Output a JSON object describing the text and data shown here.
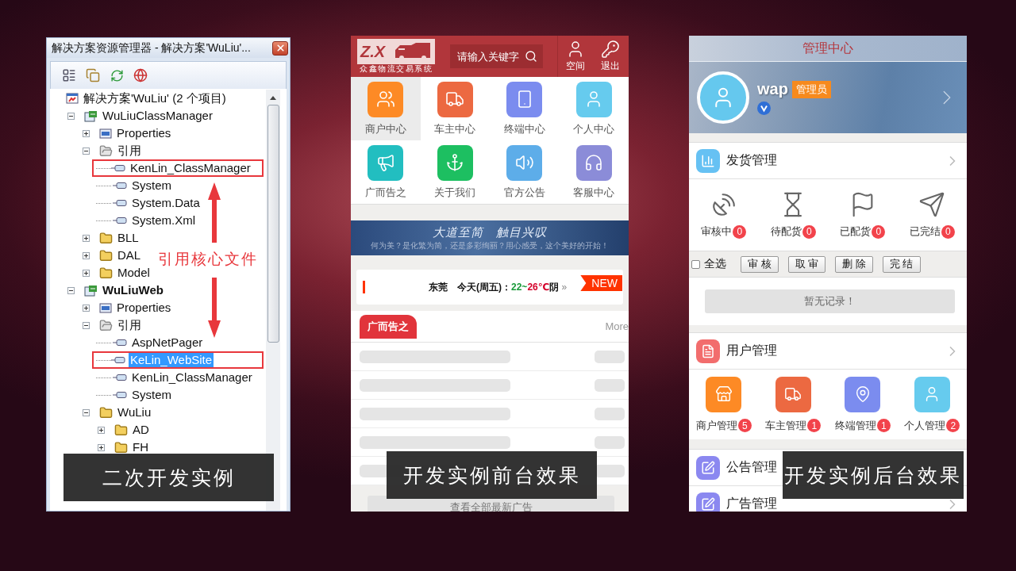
{
  "explorer": {
    "title": "解决方案资源管理器 - 解决方案'WuLiu'...",
    "tree": {
      "label": "解决方案'WuLiu' (2 个项目)",
      "kind": "solution",
      "selected": false,
      "children": [
        {
          "label": "WuLiuClassManager",
          "kind": "project",
          "selected": false,
          "bold": false,
          "expanded": true,
          "children": [
            {
              "label": "Properties",
              "kind": "properties",
              "selected": false,
              "expanded": false
            },
            {
              "label": "引用",
              "kind": "references",
              "selected": false,
              "expanded": true,
              "children": [
                {
                  "label": "KenLin_ClassManager",
                  "kind": "reference",
                  "selected": false,
                  "boxed": true
                },
                {
                  "label": "System",
                  "kind": "reference",
                  "selected": false,
                  "boxed": false
                },
                {
                  "label": "System.Data",
                  "kind": "reference",
                  "selected": false,
                  "boxed": false
                },
                {
                  "label": "System.Xml",
                  "kind": "reference",
                  "selected": false,
                  "boxed": false
                }
              ]
            },
            {
              "label": "BLL",
              "kind": "folder",
              "selected": false,
              "expanded": false
            },
            {
              "label": "DAL",
              "kind": "folder",
              "selected": false,
              "expanded": false
            },
            {
              "label": "Model",
              "kind": "folder",
              "selected": false,
              "expanded": false
            }
          ]
        },
        {
          "label": "WuLiuWeb",
          "kind": "project",
          "selected": false,
          "bold": true,
          "expanded": true,
          "children": [
            {
              "label": "Properties",
              "kind": "properties",
              "selected": false,
              "expanded": false
            },
            {
              "label": "引用",
              "kind": "references",
              "selected": false,
              "expanded": true,
              "children": [
                {
                  "label": "AspNetPager",
                  "kind": "reference",
                  "selected": false,
                  "boxed": false
                },
                {
                  "label": "KeLin_WebSite",
                  "kind": "reference",
                  "selected": true,
                  "boxed": true
                },
                {
                  "label": "KenLin_ClassManager",
                  "kind": "reference",
                  "selected": false,
                  "boxed": false
                },
                {
                  "label": "System",
                  "kind": "reference",
                  "selected": false,
                  "boxed": false
                }
              ]
            },
            {
              "label": "WuLiu",
              "kind": "folder",
              "selected": false,
              "expanded": true,
              "children": [
                {
                  "label": "AD",
                  "kind": "folder",
                  "selected": false,
                  "expanded": false
                },
                {
                  "label": "FH",
                  "kind": "folder",
                  "selected": false,
                  "expanded": false
                }
              ]
            }
          ]
        }
      ]
    },
    "annotation": "引用核心文件",
    "caption": "二次开发实例"
  },
  "front": {
    "logo": {
      "mark": "Z.X",
      "subtitle": "众鑫物流交易系统"
    },
    "search": {
      "placeholder": "请输入关键字"
    },
    "header_links": [
      {
        "label": "空间"
      },
      {
        "label": "退出"
      }
    ],
    "menu": [
      {
        "label": "商户中心",
        "color": "#fd8a25",
        "selected": true
      },
      {
        "label": "车主中心",
        "color": "#ec6941",
        "selected": false
      },
      {
        "label": "终端中心",
        "color": "#7b8cef",
        "selected": false
      },
      {
        "label": "个人中心",
        "color": "#66cbee",
        "selected": false
      },
      {
        "label": "广而告之",
        "color": "#22bec0",
        "selected": false
      },
      {
        "label": "关于我们",
        "color": "#1dbf61",
        "selected": false
      },
      {
        "label": "官方公告",
        "color": "#5dade9",
        "selected": false
      },
      {
        "label": "客服中心",
        "color": "#8b8cd8",
        "selected": false
      }
    ],
    "banner": {
      "title": "大道至简　触目兴叹",
      "subtitle": "何为美？是化繁为简，还是多彩绚丽？用心感受，这个美好的开始！"
    },
    "weather": {
      "city": "东莞",
      "day": "今天(周五)：",
      "low": "22",
      "separator": "~",
      "high": "26℃",
      "condition": "阴",
      "more": "»",
      "badge": "NEW"
    },
    "section": {
      "title": "广而告之",
      "more": "More"
    },
    "ads": [
      {
        "kind": "loading"
      },
      {
        "kind": "loading"
      },
      {
        "kind": "loading"
      },
      {
        "kind": "loading"
      },
      {
        "kind": "loading"
      }
    ],
    "more_button": "查看全部最新广告",
    "caption": "开发实例前台效果"
  },
  "admin": {
    "title": "管理中心",
    "user": {
      "name": "wap",
      "role": "管理员"
    },
    "shipping": {
      "title": "发货管理",
      "statuses": [
        {
          "label": "审核中",
          "count": "0"
        },
        {
          "label": "待配货",
          "count": "0"
        },
        {
          "label": "已配货",
          "count": "0"
        },
        {
          "label": "已完结",
          "count": "0"
        }
      ],
      "select_all": {
        "label": "全选",
        "checked": false
      },
      "actions": [
        "审 核",
        "取 审",
        "删 除",
        "完 结"
      ],
      "empty": "暂无记录！"
    },
    "users": {
      "title": "用户管理",
      "items": [
        {
          "label": "商户管理",
          "count": "5",
          "color": "#fd8a25"
        },
        {
          "label": "车主管理",
          "count": "1",
          "color": "#ec6941"
        },
        {
          "label": "终端管理",
          "count": "1",
          "color": "#7b8cef"
        },
        {
          "label": "个人管理",
          "count": "2",
          "color": "#66cbee"
        }
      ]
    },
    "links": [
      {
        "title": "公告管理"
      },
      {
        "title": "广告管理"
      }
    ],
    "caption": "开发实例后台效果"
  }
}
